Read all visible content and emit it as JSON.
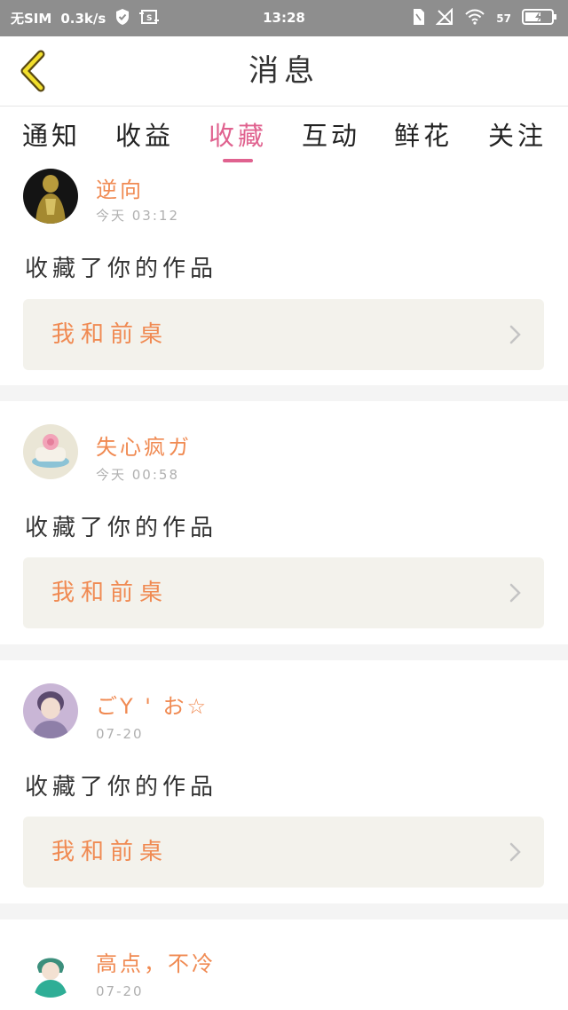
{
  "status_bar": {
    "carrier": "无SIM",
    "speed": "0.3k/s",
    "time": "13:28",
    "battery": "57"
  },
  "header": {
    "title": "消息",
    "back_icon": "chevron-left-icon"
  },
  "tabs": [
    {
      "label": "通知",
      "active": false
    },
    {
      "label": "收益",
      "active": false
    },
    {
      "label": "收藏",
      "active": true
    },
    {
      "label": "互动",
      "active": false
    },
    {
      "label": "鲜花",
      "active": false
    },
    {
      "label": "关注",
      "active": false
    }
  ],
  "colors": {
    "accent": "#e0628f",
    "username": "#f08a52",
    "card_link_bg": "#f3f2ec"
  },
  "messages": [
    {
      "username": "逆向",
      "time": "今天 03:12",
      "action": "收藏了你的作品",
      "work": "我和前桌"
    },
    {
      "username": "失心疯ガ",
      "time": "今天 00:58",
      "action": "收藏了你的作品",
      "work": "我和前桌"
    },
    {
      "username": "ごY ' お☆",
      "time": "07-20",
      "action": "收藏了你的作品",
      "work": "我和前桌"
    },
    {
      "username": "高点，不冷",
      "time": "07-20",
      "action": "",
      "work": ""
    }
  ]
}
